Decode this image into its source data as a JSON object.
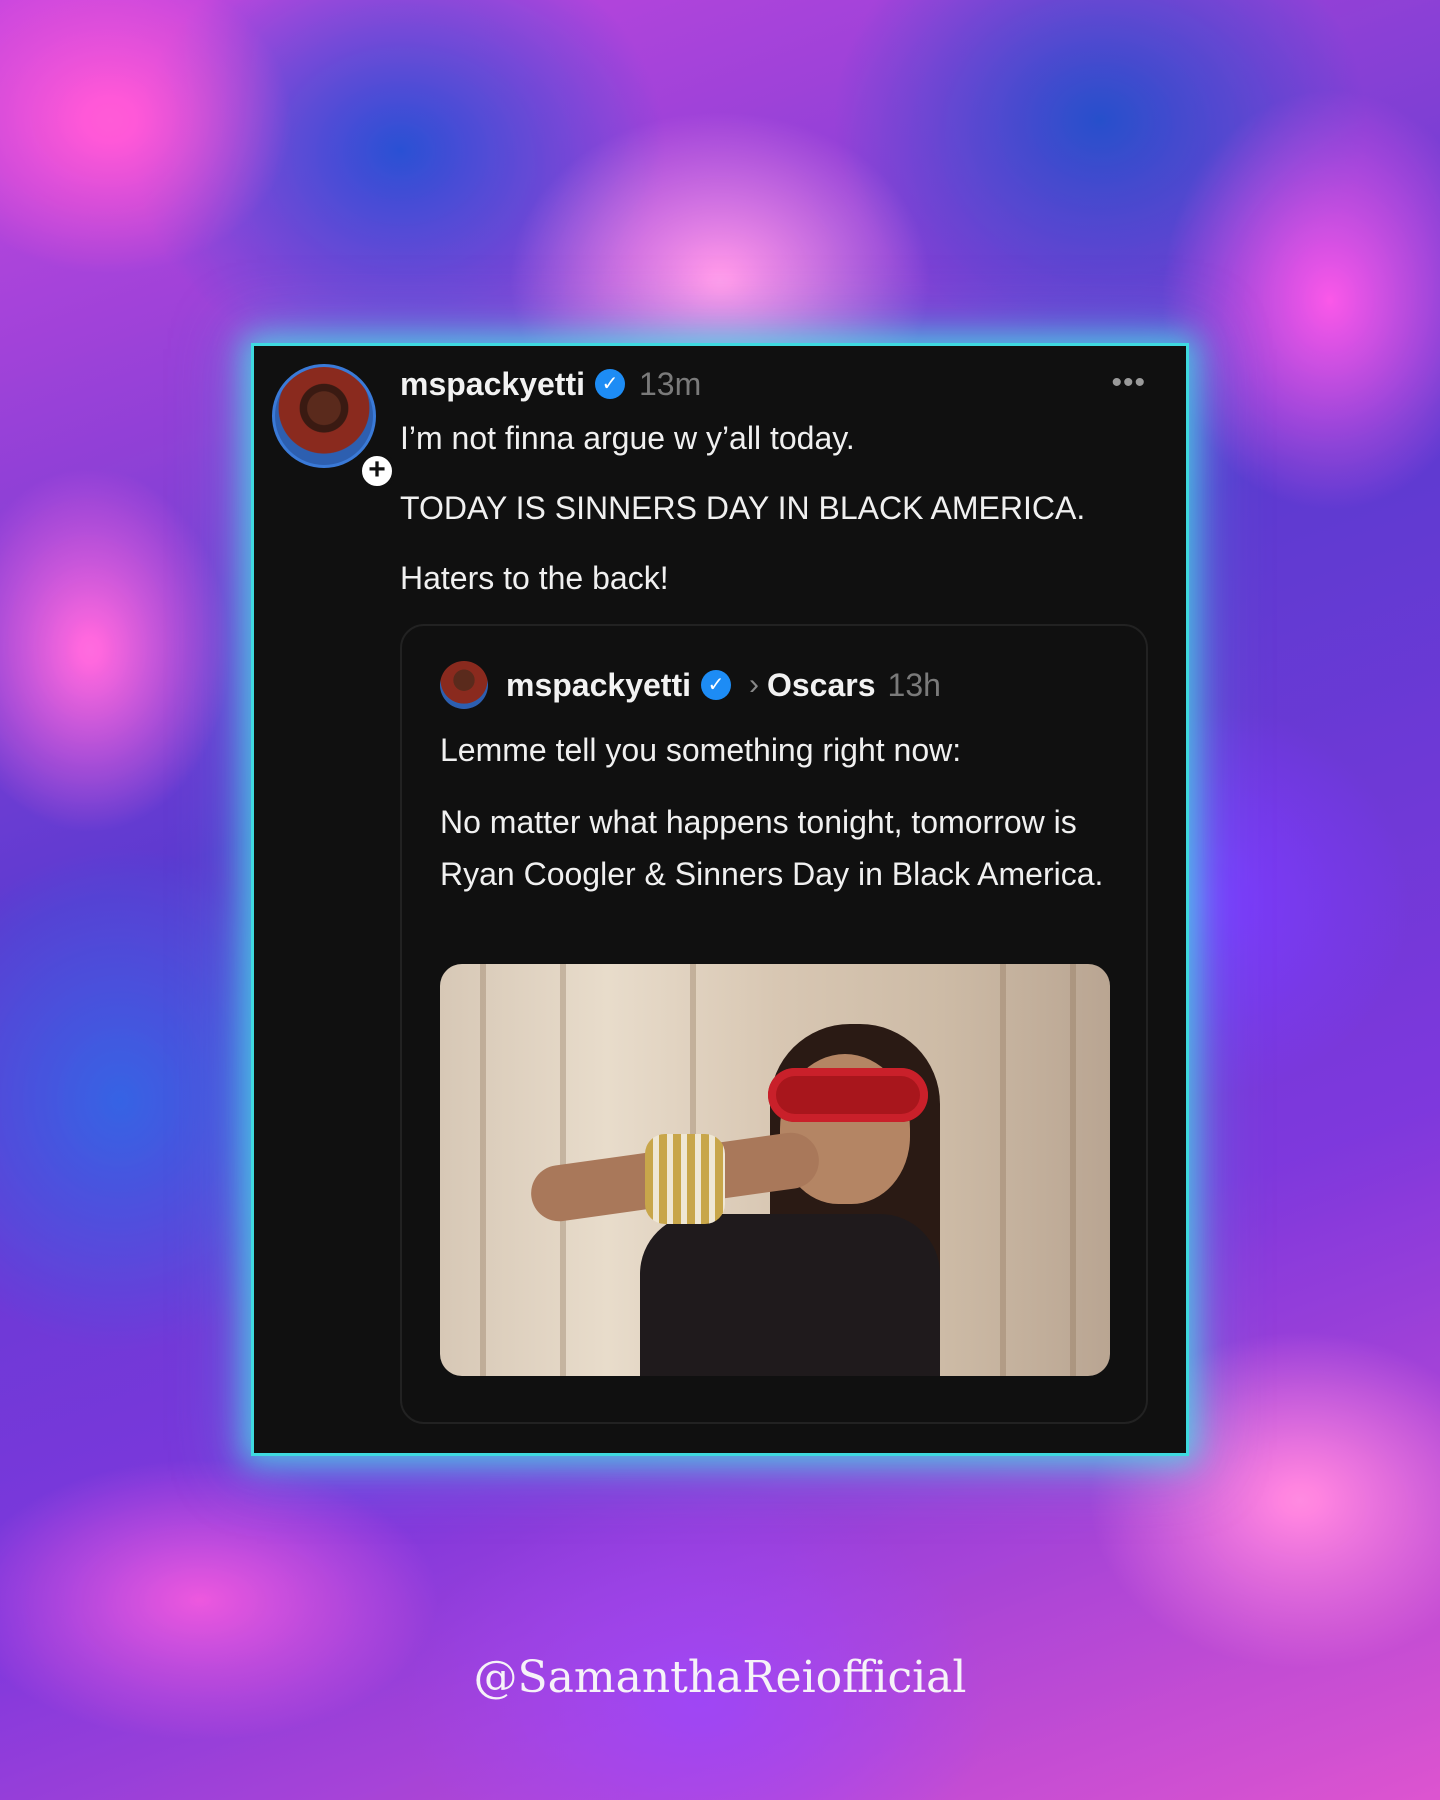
{
  "post": {
    "handle": "mspackyetti",
    "time": "13m",
    "more": "•••",
    "follow": "+",
    "verified": "✓",
    "lines": [
      "I’m not finna argue w y’all today.",
      "TODAY IS SINNERS DAY IN BLACK AMERICA.",
      "Haters to the back!"
    ]
  },
  "quoted": {
    "handle": "mspackyetti",
    "verified": "✓",
    "chevron": "›",
    "community": "Oscars",
    "time": "13h",
    "line1": "Lemme tell you something right now:",
    "body": "No matter what happens tonight, tomorrow is Ryan Coogler & Sinners Day in Black America."
  },
  "watermark": "@SamanthaReiofficial",
  "colors": {
    "card_bg": "#101010",
    "glow": "#3fd9e0",
    "verified_blue": "#1d8cf5",
    "muted_text": "#7a7a7a"
  }
}
